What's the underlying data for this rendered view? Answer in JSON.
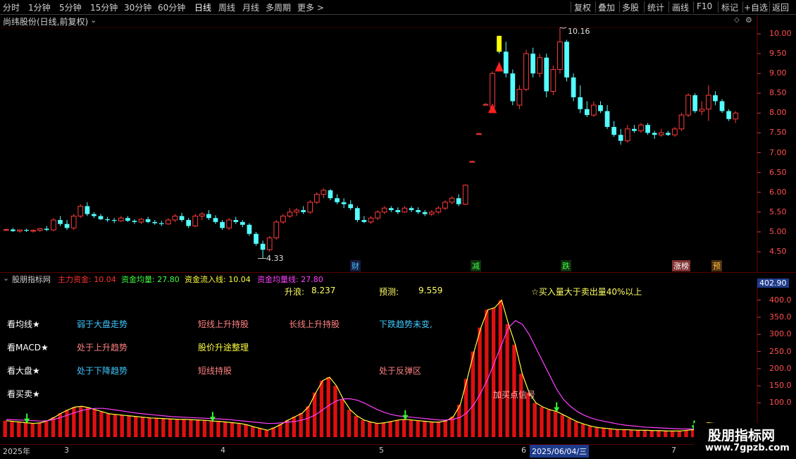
{
  "toolbar": {
    "periods": [
      "分时",
      "1分钟",
      "5分钟",
      "15分钟",
      "30分钟",
      "60分钟",
      "日线",
      "周线",
      "月线",
      "多周期",
      "更多 >"
    ],
    "active_period": "日线",
    "actions": [
      "复权",
      "叠加",
      "多股",
      "统计",
      "画线",
      "F10",
      "标记",
      "+自选",
      "返回"
    ]
  },
  "main_panel": {
    "title": "尚纬股份(日线,前复权)",
    "price_axis": [
      "10.00",
      "9.50",
      "9.00",
      "8.50",
      "8.00",
      "7.50",
      "7.00",
      "6.50",
      "6.00",
      "5.50",
      "5.00",
      "4.50"
    ],
    "high_label": "10.16",
    "low_label": "4.33",
    "event_markers": [
      "财",
      "减",
      "跌",
      "涨榜",
      "预"
    ]
  },
  "indicator_panel": {
    "name": "股朋指标网",
    "series_readout": [
      {
        "label": "主力资金: 10.04",
        "color": "#ff3030"
      },
      {
        "label": "资金均量: 27.80",
        "color": "#40ff40"
      },
      {
        "label": "资金流入线: 10.04",
        "color": "#ffff40"
      },
      {
        "label": "资金均量线: 27.80",
        "color": "#ff40ff"
      }
    ],
    "current_value": "402.90",
    "axis": [
      "400.0",
      "350.0",
      "300.0",
      "250.0",
      "200.0",
      "150.0",
      "100.0"
    ],
    "info": {
      "rise_label": "升浪:",
      "rise_value": "8.237",
      "forecast_label": "预测:",
      "forecast_value": "9.559",
      "buy_note": "☆买入量大于卖出量40%以上"
    },
    "rows": [
      {
        "label": "看均线★",
        "cells": [
          {
            "text": "弱于大盘走势",
            "color": "#40c8ff"
          },
          {
            "text": "短线上升持股",
            "color": "#ff8080"
          },
          {
            "text": "长线上升持股",
            "color": "#ff8080"
          },
          {
            "text": "下跌趋势未变,",
            "color": "#40c8ff"
          }
        ]
      },
      {
        "label": "看MACD★",
        "cells": [
          {
            "text": "处于上升趋势",
            "color": "#ff8080"
          },
          {
            "text": "股价升途整理",
            "color": "#ffff40"
          }
        ]
      },
      {
        "label": "看大盘★",
        "cells": [
          {
            "text": "处于下降趋势",
            "color": "#40c8ff"
          },
          {
            "text": "短线持股",
            "color": "#ff8080"
          },
          {
            "text": "处于反弹区",
            "color": "#ff8080"
          }
        ]
      },
      {
        "label": "看买卖★",
        "cells": []
      }
    ],
    "signal_label": "加买点信号"
  },
  "date_axis": {
    "labels": [
      "2025年",
      "3",
      "4",
      "5",
      "6",
      "7"
    ],
    "cursor_date": "2025/06/04/三"
  },
  "watermark": {
    "text": "股朋指标网",
    "url": "www.7gpzb.com"
  },
  "chart_data": {
    "type": "candlestick",
    "ylim": [
      4.2,
      10.4
    ],
    "candles": [
      [
        5.05,
        5.08,
        5.02,
        5.06
      ],
      [
        5.06,
        5.1,
        5.0,
        5.02
      ],
      [
        5.02,
        5.06,
        4.98,
        5.05
      ],
      [
        5.05,
        5.08,
        5.0,
        5.03
      ],
      [
        5.03,
        5.06,
        4.98,
        5.04
      ],
      [
        5.04,
        5.1,
        5.0,
        5.08
      ],
      [
        5.08,
        5.15,
        5.02,
        5.05
      ],
      [
        5.05,
        5.35,
        5.02,
        5.3
      ],
      [
        5.3,
        5.4,
        5.15,
        5.2
      ],
      [
        5.2,
        5.3,
        5.05,
        5.1
      ],
      [
        5.1,
        5.45,
        5.05,
        5.4
      ],
      [
        5.4,
        5.7,
        5.35,
        5.65
      ],
      [
        5.65,
        5.75,
        5.4,
        5.45
      ],
      [
        5.45,
        5.5,
        5.35,
        5.4
      ],
      [
        5.4,
        5.45,
        5.3,
        5.32
      ],
      [
        5.32,
        5.38,
        5.25,
        5.3
      ],
      [
        5.3,
        5.35,
        5.22,
        5.28
      ],
      [
        5.28,
        5.4,
        5.25,
        5.35
      ],
      [
        5.35,
        5.4,
        5.25,
        5.28
      ],
      [
        5.28,
        5.32,
        5.2,
        5.25
      ],
      [
        5.25,
        5.35,
        5.2,
        5.32
      ],
      [
        5.32,
        5.38,
        5.22,
        5.25
      ],
      [
        5.25,
        5.3,
        5.18,
        5.22
      ],
      [
        5.22,
        5.28,
        5.15,
        5.2
      ],
      [
        5.2,
        5.35,
        5.18,
        5.3
      ],
      [
        5.3,
        5.45,
        5.25,
        5.4
      ],
      [
        5.4,
        5.48,
        5.25,
        5.3
      ],
      [
        5.3,
        5.35,
        5.1,
        5.15
      ],
      [
        5.15,
        5.45,
        5.12,
        5.4
      ],
      [
        5.4,
        5.5,
        5.3,
        5.45
      ],
      [
        5.45,
        5.55,
        5.3,
        5.35
      ],
      [
        5.35,
        5.42,
        5.2,
        5.25
      ],
      [
        5.25,
        5.3,
        5.05,
        5.1
      ],
      [
        5.1,
        5.35,
        5.05,
        5.3
      ],
      [
        5.3,
        5.38,
        5.2,
        5.25
      ],
      [
        5.25,
        5.3,
        5.12,
        5.18
      ],
      [
        5.18,
        5.22,
        4.9,
        4.95
      ],
      [
        4.95,
        5.0,
        4.65,
        4.7
      ],
      [
        4.7,
        4.78,
        4.33,
        4.55
      ],
      [
        4.55,
        4.9,
        4.5,
        4.85
      ],
      [
        4.85,
        5.3,
        4.8,
        5.25
      ],
      [
        5.25,
        5.45,
        5.2,
        5.4
      ],
      [
        5.4,
        5.6,
        5.35,
        5.5
      ],
      [
        5.5,
        5.6,
        5.4,
        5.55
      ],
      [
        5.55,
        5.65,
        5.45,
        5.5
      ],
      [
        5.5,
        5.8,
        5.45,
        5.75
      ],
      [
        5.75,
        6.0,
        5.7,
        5.95
      ],
      [
        5.95,
        6.1,
        5.85,
        6.05
      ],
      [
        6.05,
        6.08,
        5.8,
        5.85
      ],
      [
        5.85,
        5.95,
        5.7,
        5.75
      ],
      [
        5.75,
        5.85,
        5.6,
        5.7
      ],
      [
        5.7,
        5.8,
        5.55,
        5.6
      ],
      [
        5.6,
        5.65,
        5.25,
        5.3
      ],
      [
        5.3,
        5.4,
        5.22,
        5.25
      ],
      [
        5.25,
        5.4,
        5.2,
        5.35
      ],
      [
        5.35,
        5.55,
        5.3,
        5.5
      ],
      [
        5.5,
        5.65,
        5.45,
        5.6
      ],
      [
        5.6,
        5.65,
        5.5,
        5.55
      ],
      [
        5.55,
        5.62,
        5.45,
        5.5
      ],
      [
        5.5,
        5.65,
        5.48,
        5.6
      ],
      [
        5.6,
        5.65,
        5.5,
        5.55
      ],
      [
        5.55,
        5.62,
        5.45,
        5.5
      ],
      [
        5.5,
        5.55,
        5.4,
        5.45
      ],
      [
        5.45,
        5.55,
        5.4,
        5.5
      ],
      [
        5.5,
        5.65,
        5.45,
        5.6
      ],
      [
        5.6,
        5.8,
        5.55,
        5.75
      ],
      [
        5.75,
        5.9,
        5.7,
        5.85
      ],
      [
        5.85,
        5.95,
        5.65,
        5.7
      ],
      [
        5.7,
        6.2,
        5.68,
        6.18
      ],
      [
        6.78,
        6.8,
        6.76,
        6.78
      ],
      [
        7.48,
        7.5,
        7.46,
        7.48
      ],
      [
        8.22,
        8.25,
        8.2,
        8.22
      ],
      [
        8.15,
        9.05,
        8.1,
        9.0
      ],
      [
        9.9,
        9.95,
        9.5,
        9.55
      ],
      [
        9.55,
        9.8,
        8.9,
        9.0
      ],
      [
        9.0,
        9.1,
        8.2,
        8.3
      ],
      [
        8.2,
        8.7,
        8.1,
        8.6
      ],
      [
        8.6,
        9.6,
        8.55,
        9.5
      ],
      [
        9.5,
        9.65,
        8.9,
        9.0
      ],
      [
        9.0,
        9.5,
        8.9,
        9.4
      ],
      [
        9.4,
        9.5,
        8.4,
        8.55
      ],
      [
        8.55,
        9.2,
        8.45,
        9.1
      ],
      [
        9.1,
        10.16,
        9.0,
        9.8
      ],
      [
        9.8,
        9.85,
        8.8,
        8.9
      ],
      [
        8.9,
        9.0,
        8.3,
        8.4
      ],
      [
        8.4,
        8.7,
        8.0,
        8.1
      ],
      [
        8.1,
        8.3,
        7.9,
        7.95
      ],
      [
        7.95,
        8.3,
        7.9,
        8.2
      ],
      [
        8.2,
        8.3,
        8.0,
        8.05
      ],
      [
        8.05,
        8.2,
        7.6,
        7.65
      ],
      [
        7.65,
        7.8,
        7.4,
        7.45
      ],
      [
        7.45,
        7.6,
        7.2,
        7.3
      ],
      [
        7.3,
        7.7,
        7.25,
        7.6
      ],
      [
        7.6,
        7.7,
        7.5,
        7.55
      ],
      [
        7.55,
        7.75,
        7.5,
        7.7
      ],
      [
        7.7,
        7.75,
        7.45,
        7.5
      ],
      [
        7.5,
        7.55,
        7.35,
        7.45
      ],
      [
        7.45,
        7.6,
        7.4,
        7.5
      ],
      [
        7.5,
        7.55,
        7.42,
        7.45
      ],
      [
        7.45,
        7.65,
        7.4,
        7.6
      ],
      [
        7.6,
        8.0,
        7.55,
        7.95
      ],
      [
        7.95,
        8.5,
        7.9,
        8.45
      ],
      [
        8.45,
        8.5,
        8.0,
        8.05
      ],
      [
        8.05,
        8.3,
        7.95,
        8.1
      ],
      [
        8.1,
        8.7,
        7.8,
        8.45
      ],
      [
        8.45,
        8.55,
        8.2,
        8.3
      ],
      [
        8.3,
        8.35,
        8.0,
        8.05
      ],
      [
        8.05,
        8.1,
        7.8,
        7.85
      ],
      [
        7.85,
        8.05,
        7.75,
        8.0
      ]
    ],
    "indicator": {
      "bars": [
        48,
        46,
        44,
        42,
        40,
        42,
        48,
        58,
        70,
        80,
        88,
        90,
        86,
        80,
        74,
        68,
        66,
        64,
        62,
        60,
        58,
        56,
        55,
        54,
        53,
        52,
        52,
        51,
        50,
        49,
        47,
        46,
        44,
        42,
        40,
        36,
        30,
        25,
        20,
        28,
        38,
        50,
        60,
        70,
        90,
        130,
        165,
        175,
        150,
        110,
        80,
        62,
        50,
        44,
        40,
        42,
        46,
        50,
        52,
        50,
        48,
        46,
        44,
        44,
        48,
        60,
        95,
        170,
        250,
        320,
        372,
        378,
        400,
        330,
        270,
        185,
        130,
        100,
        88,
        80,
        75,
        65,
        55,
        45,
        38,
        32,
        28,
        26,
        24,
        22,
        22,
        21,
        20,
        20,
        19,
        19,
        18,
        18,
        18,
        20,
        22,
        35,
        42,
        40,
        38,
        36,
        35
      ],
      "ma": [
        52,
        51,
        50,
        49,
        48,
        47,
        48,
        52,
        58,
        65,
        72,
        78,
        82,
        84,
        84,
        82,
        79,
        76,
        73,
        70,
        68,
        66,
        64,
        62,
        60,
        59,
        58,
        57,
        56,
        55,
        54,
        53,
        52,
        50,
        48,
        46,
        44,
        42,
        40,
        40,
        42,
        44,
        46,
        50,
        56,
        66,
        80,
        94,
        106,
        112,
        112,
        108,
        100,
        90,
        80,
        72,
        66,
        62,
        60,
        58,
        56,
        54,
        52,
        50,
        50,
        52,
        58,
        72,
        96,
        130,
        170,
        220,
        270,
        320,
        340,
        330,
        300,
        260,
        220,
        180,
        140,
        110,
        90,
        75,
        64,
        56,
        50,
        46,
        42,
        38,
        35,
        33,
        31,
        29,
        28,
        27,
        26,
        25,
        24,
        24,
        24,
        26,
        28,
        30,
        32,
        34,
        35
      ],
      "ylim": [
        0,
        420
      ]
    }
  }
}
